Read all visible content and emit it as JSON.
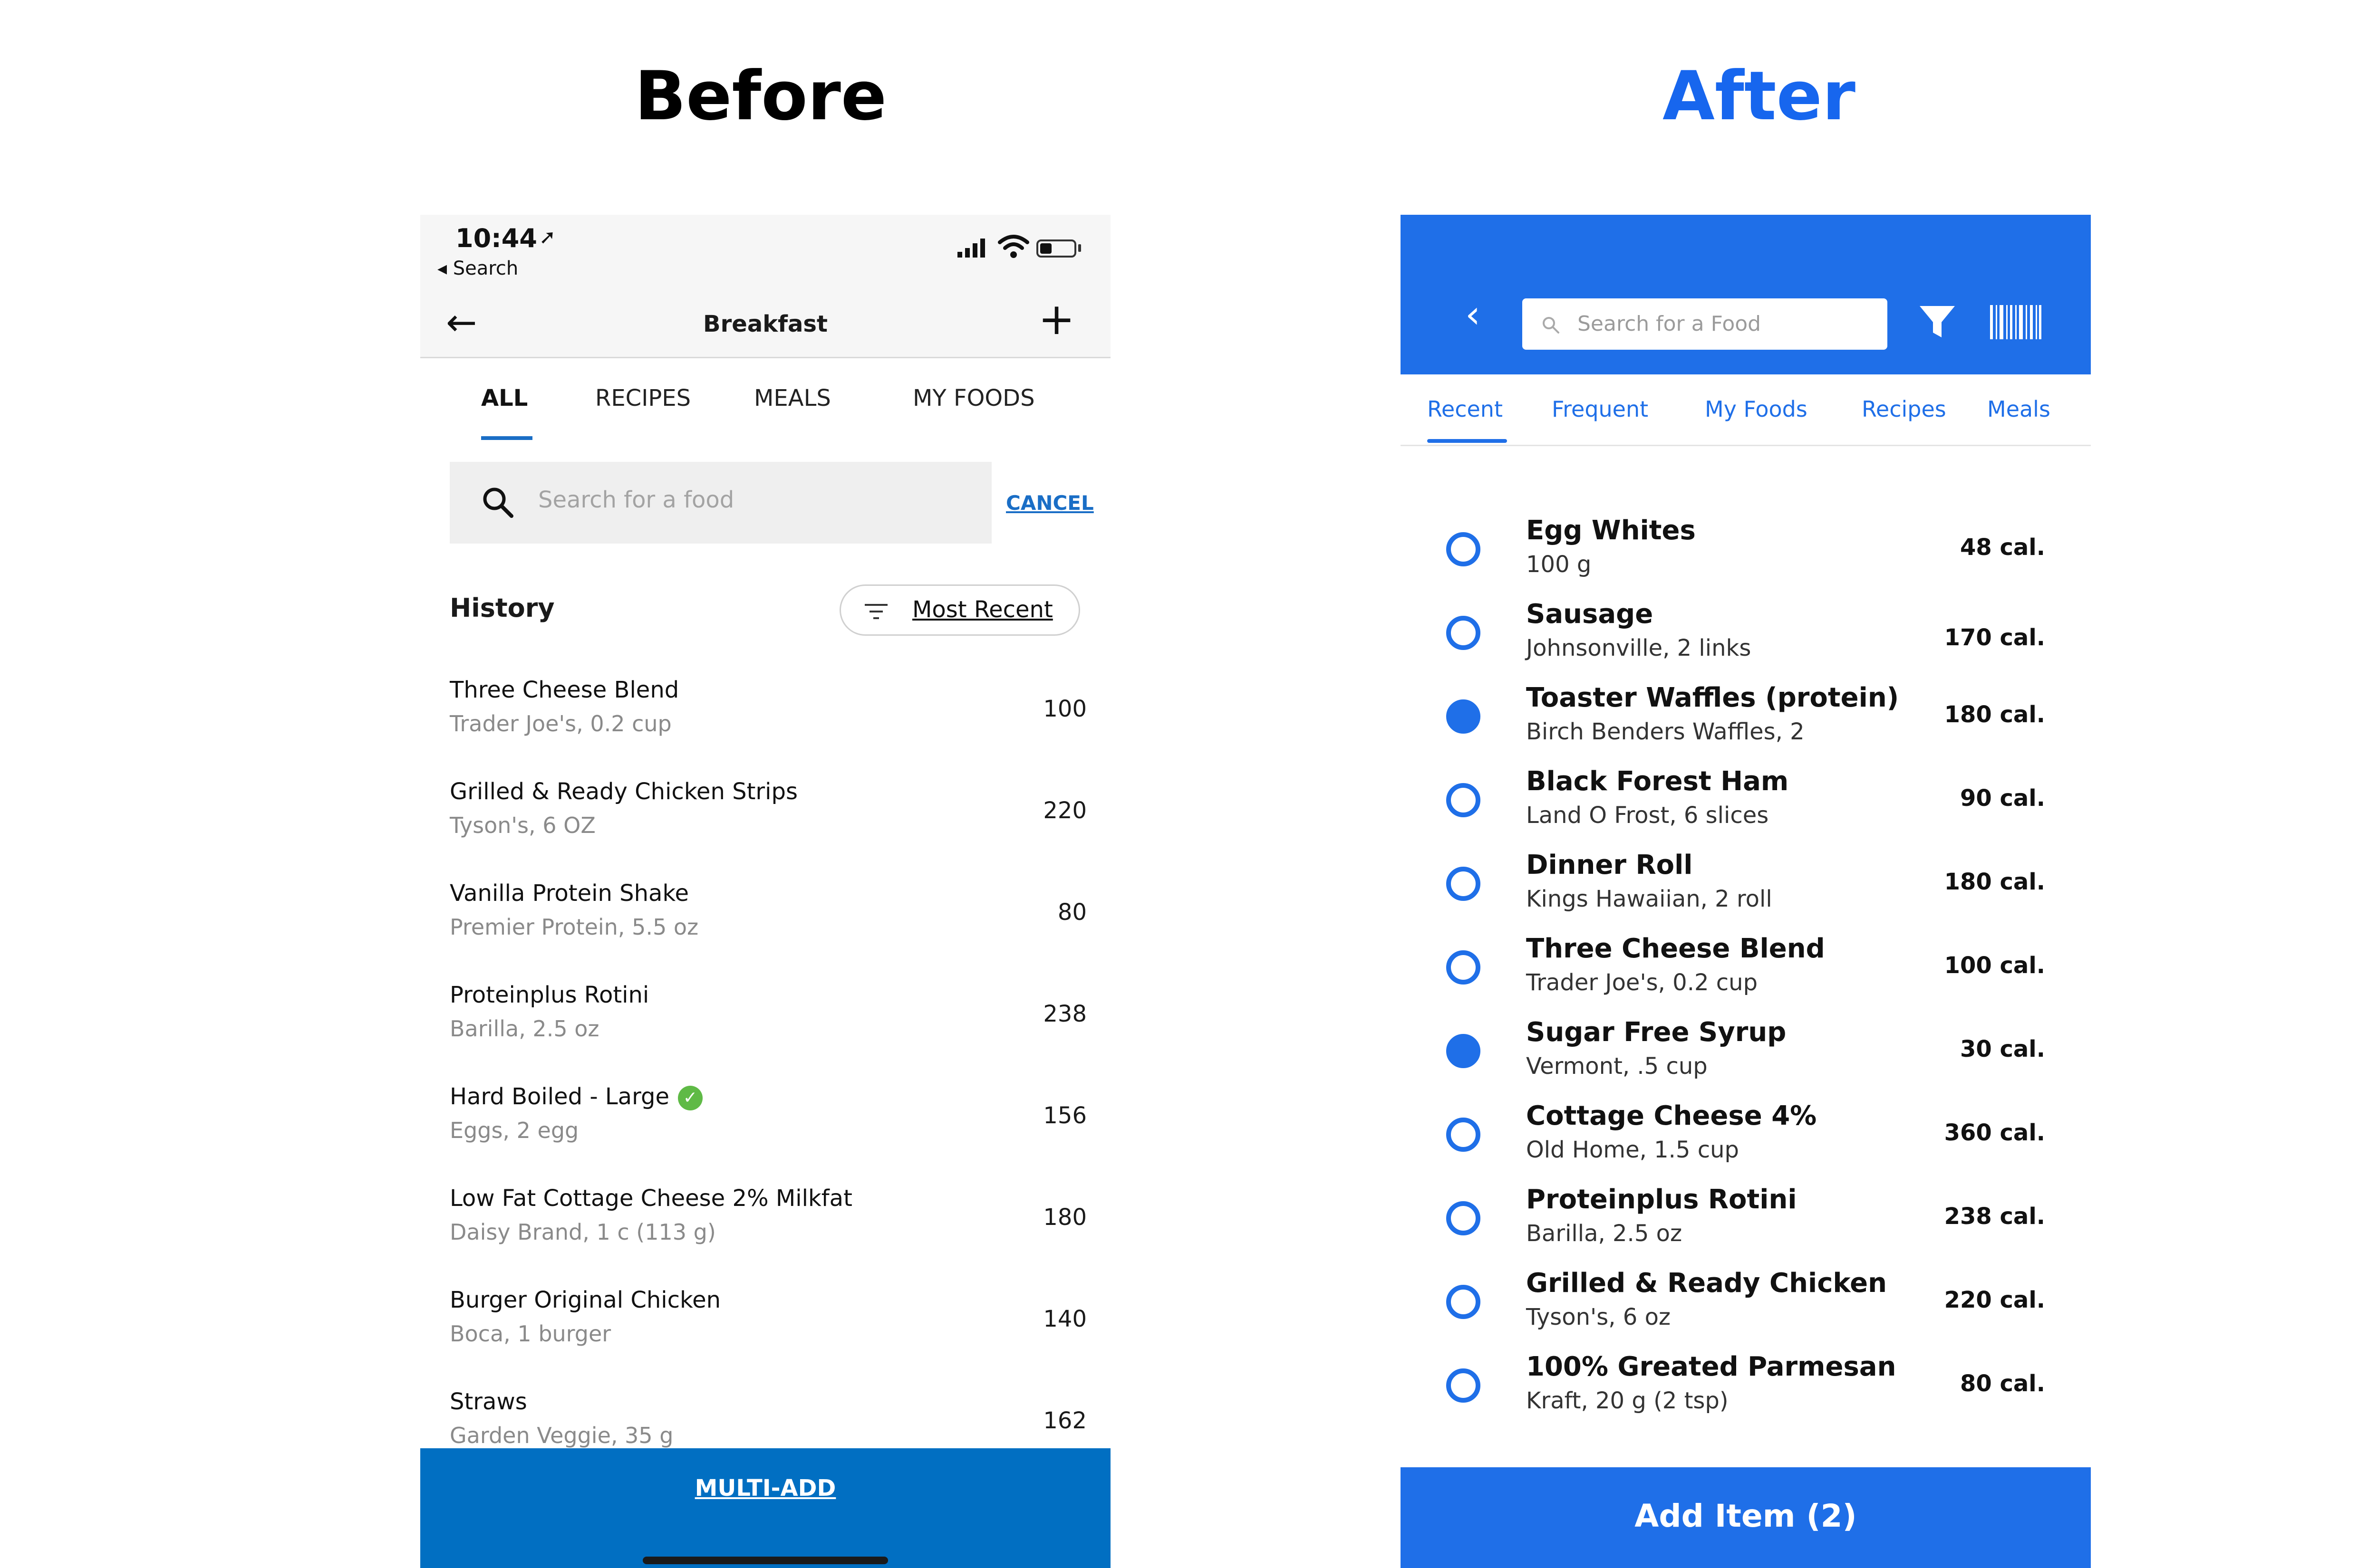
{
  "headlines": {
    "before": "Before",
    "after": "After"
  },
  "colors": {
    "before_accent": "#016fc2",
    "after_accent": "#1f6fe8",
    "after_headline": "#1766ee"
  },
  "before": {
    "status": {
      "time": "10:44",
      "location_icon": "location-arrow-icon",
      "back_label": "◂ Search"
    },
    "nav": {
      "back_icon": "arrow-left-icon",
      "title": "Breakfast",
      "add_icon": "plus-icon"
    },
    "tabs": [
      {
        "label": "ALL",
        "active": true
      },
      {
        "label": "RECIPES"
      },
      {
        "label": "MEALS"
      },
      {
        "label": "MY FOODS"
      }
    ],
    "search": {
      "placeholder": "Search for a food",
      "cancel": "CANCEL"
    },
    "history": {
      "title": "History",
      "sort_label": "Most Recent"
    },
    "items": [
      {
        "name": "Three Cheese Blend",
        "sub": "Trader Joe's, 0.2 cup",
        "cal": "100"
      },
      {
        "name": "Grilled & Ready Chicken Strips",
        "sub": "Tyson's, 6 OZ",
        "cal": "220"
      },
      {
        "name": "Vanilla Protein Shake",
        "sub": "Premier Protein, 5.5 oz",
        "cal": "80"
      },
      {
        "name": "Proteinplus Rotini",
        "sub": "Barilla, 2.5 oz",
        "cal": "238"
      },
      {
        "name": "Hard Boiled - Large",
        "sub": "Eggs, 2 egg",
        "cal": "156",
        "verified": true
      },
      {
        "name": "Low Fat Cottage Cheese 2% Milkfat",
        "sub": "Daisy Brand, 1 c  (113 g)",
        "cal": "180"
      },
      {
        "name": "Burger Original Chicken",
        "sub": "Boca, 1 burger",
        "cal": "140"
      },
      {
        "name": "Straws",
        "sub": "Garden Veggie, 35 g",
        "cal": "162"
      }
    ],
    "multi_add": "MULTI-ADD"
  },
  "after": {
    "header": {
      "back_icon": "chevron-left-icon",
      "search_placeholder": "Search for a Food",
      "filter_icon": "filter-icon",
      "barcode_icon": "barcode-icon"
    },
    "tabs": [
      {
        "label": "Recent",
        "active": true
      },
      {
        "label": "Frequent"
      },
      {
        "label": "My Foods"
      },
      {
        "label": "Recipes"
      },
      {
        "label": "Meals"
      }
    ],
    "items": [
      {
        "name": "Egg Whites",
        "sub": "100 g",
        "cal": "48 cal.",
        "checked": false
      },
      {
        "name": "Sausage",
        "sub": "Johnsonville, 2 links",
        "cal": "170 cal.",
        "checked": false
      },
      {
        "name": "Toaster Waffles (protein)",
        "sub": "Birch Benders Waffles, 2",
        "cal": "180 cal.",
        "checked": true
      },
      {
        "name": "Black Forest Ham",
        "sub": "Land O Frost, 6 slices",
        "cal": "90 cal.",
        "checked": false
      },
      {
        "name": "Dinner Roll",
        "sub": "Kings Hawaiian, 2 roll",
        "cal": "180 cal.",
        "checked": false
      },
      {
        "name": "Three Cheese Blend",
        "sub": "Trader Joe's, 0.2 cup",
        "cal": "100 cal.",
        "checked": false
      },
      {
        "name": "Sugar Free Syrup",
        "sub": "Vermont, .5 cup",
        "cal": "30 cal.",
        "checked": true
      },
      {
        "name": "Cottage Cheese 4%",
        "sub": "Old Home, 1.5 cup",
        "cal": "360 cal.",
        "checked": false
      },
      {
        "name": "Proteinplus Rotini",
        "sub": "Barilla, 2.5 oz",
        "cal": "238 cal.",
        "checked": false
      },
      {
        "name": "Grilled & Ready Chicken",
        "sub": "Tyson's, 6 oz",
        "cal": "220 cal.",
        "checked": false
      },
      {
        "name": "100% Greated Parmesan",
        "sub": "Kraft, 20 g (2 tsp)",
        "cal": "80 cal.",
        "checked": false
      }
    ],
    "add_button": "Add Item (2)"
  }
}
